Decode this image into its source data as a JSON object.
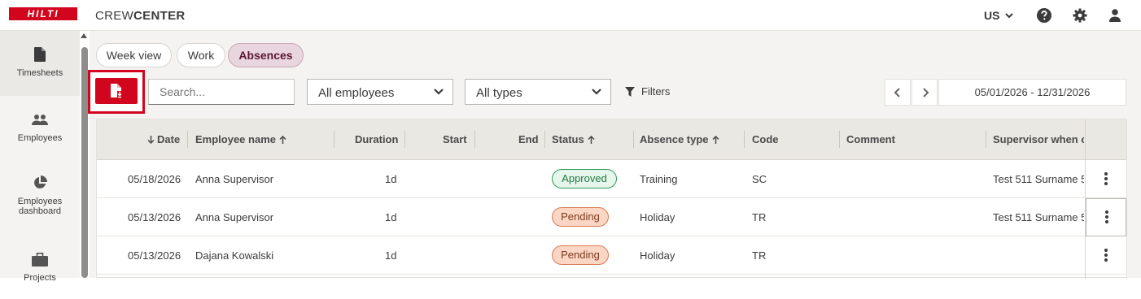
{
  "header": {
    "logo_text": "HILTI",
    "app_name_light": "CREW",
    "app_name_bold": "CENTER",
    "language": "US",
    "icons": [
      "help-icon",
      "gear-icon",
      "user-icon"
    ],
    "brand_color": "#d2051e"
  },
  "sidebar": {
    "items": [
      {
        "label": "Timesheets",
        "icon": "document-icon"
      },
      {
        "label": "Employees",
        "icon": "people-icon"
      },
      {
        "label": "Employees dashboard",
        "icon": "pie-chart-icon"
      },
      {
        "label": "Projects",
        "icon": "briefcase-icon"
      }
    ]
  },
  "tabs": [
    {
      "label": "Week view",
      "active": false
    },
    {
      "label": "Work",
      "active": false
    },
    {
      "label": "Absences",
      "active": true
    }
  ],
  "toolbar": {
    "search_placeholder": "Search...",
    "employees_select": "All employees",
    "types_select": "All types",
    "filters_label": "Filters",
    "date_range": "05/01/2026 - 12/31/2026"
  },
  "table": {
    "columns": {
      "date": "Date",
      "employee": "Employee name",
      "duration": "Duration",
      "start": "Start",
      "end": "End",
      "status": "Status",
      "absence_type": "Absence type",
      "code": "Code",
      "comment": "Comment",
      "supervisor": "Supervisor when cr"
    },
    "rows": [
      {
        "date": "05/18/2026",
        "employee": "Anna Supervisor",
        "duration": "1d",
        "start": "",
        "end": "",
        "status": "Approved",
        "absence_type": "Training",
        "code": "SC",
        "comment": "",
        "supervisor": "Test 511 Surname 5"
      },
      {
        "date": "05/13/2026",
        "employee": "Anna Supervisor",
        "duration": "1d",
        "start": "",
        "end": "",
        "status": "Pending",
        "absence_type": "Holiday",
        "code": "TR",
        "comment": "",
        "supervisor": "Test 511 Surname 5"
      },
      {
        "date": "05/13/2026",
        "employee": "Dajana Kowalski",
        "duration": "1d",
        "start": "",
        "end": "",
        "status": "Pending",
        "absence_type": "Holiday",
        "code": "TR",
        "comment": "",
        "supervisor": ""
      }
    ]
  }
}
